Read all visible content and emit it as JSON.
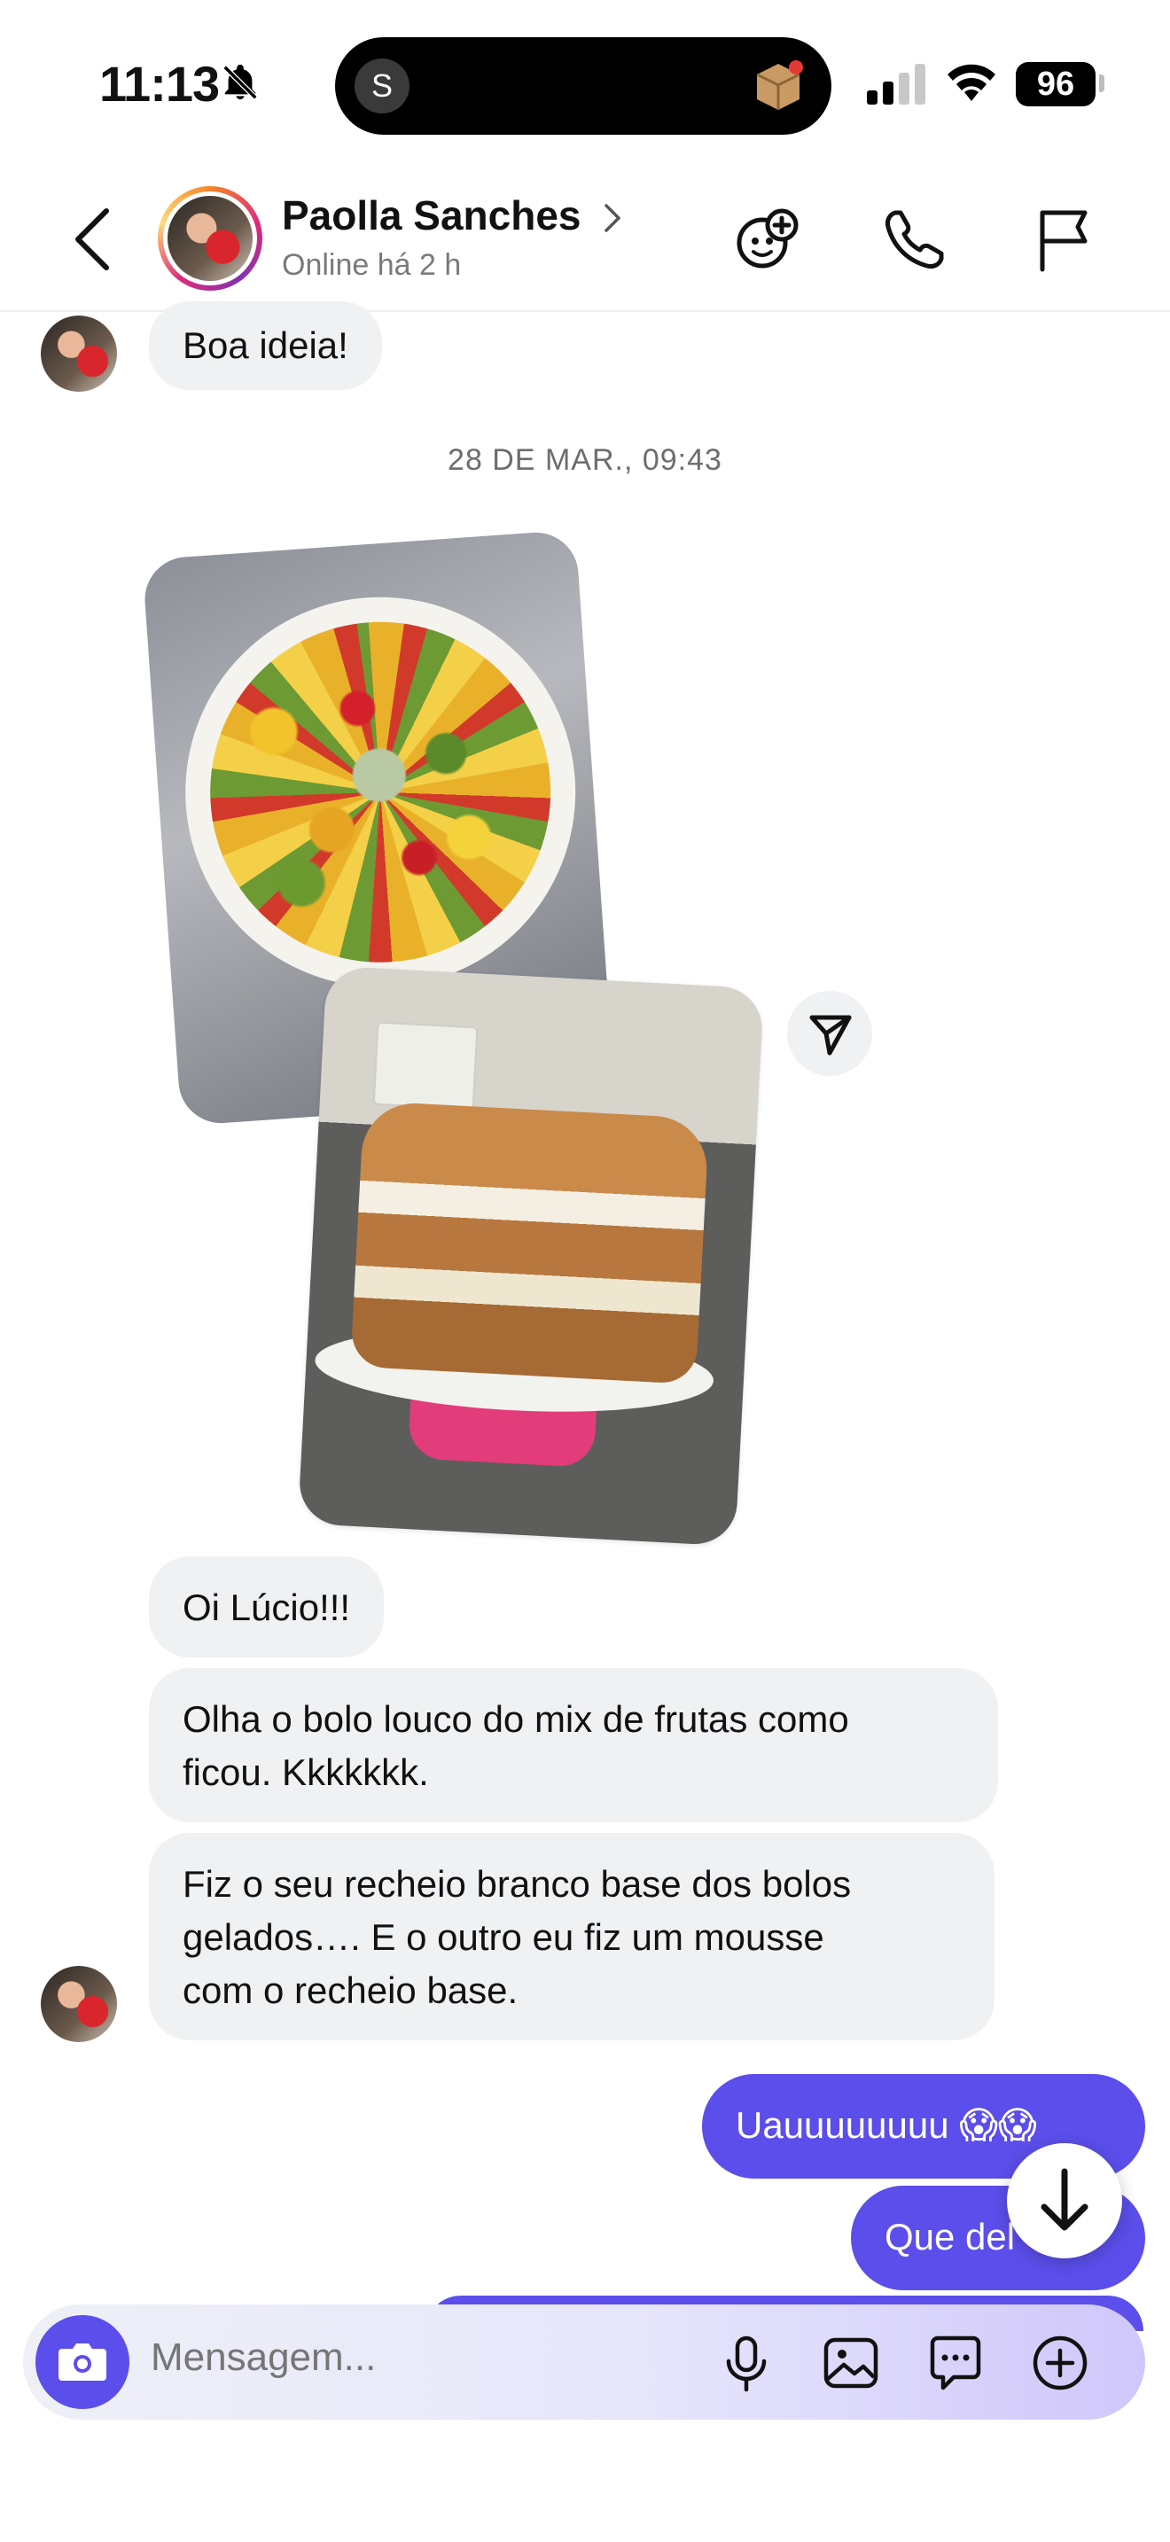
{
  "status_bar": {
    "time": "11:13",
    "island_initial": "S",
    "battery": "96",
    "icons": [
      "bell-slash-icon",
      "cellular-signal-icon",
      "wifi-icon",
      "battery-icon",
      "package-icon"
    ]
  },
  "header": {
    "contact_name": "Paolla Sanches",
    "status": "Online há 2 h",
    "icons": [
      "back-chevron-icon",
      "chevron-right-icon",
      "add-people-icon",
      "phone-icon",
      "flag-icon"
    ]
  },
  "messages": {
    "top_incoming": "Boa ideia!",
    "date_separator": "28 DE MAR., 09:43",
    "incoming": [
      "Oi Lúcio!!!",
      "Olha o bolo louco do mix de frutas como ficou. Kkkkkkk.",
      "Fiz o seu recheio branco base dos bolos gelados…. E o outro eu fiz um mousse com o recheio base."
    ],
    "incoming_lines": {
      "msg2": [
        "Olha o bolo louco do mix de frutas como",
        "ficou. Kkkkkkk."
      ],
      "msg3": [
        "Fiz o seu recheio branco base dos bolos",
        "gelados…. E o outro eu fiz um mousse",
        "com o recheio base."
      ]
    },
    "outgoing": [
      "Uauuuuuuuu 😱😱",
      "Que del"
    ],
    "photos": [
      "fruit-filling-photo",
      "layered-cake-photo"
    ]
  },
  "composer": {
    "placeholder": "Mensagem...",
    "icons": [
      "camera-icon",
      "microphone-icon",
      "gallery-icon",
      "sticker-icon",
      "plus-icon"
    ]
  },
  "colors": {
    "accent": "#5b4eea",
    "incoming_bubble": "#f0f1f3",
    "text_secondary": "#7a7a7a"
  }
}
